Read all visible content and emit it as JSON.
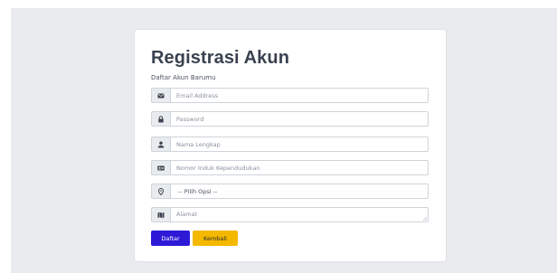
{
  "form": {
    "title": "Registrasi Akun",
    "subtitle": "Daftar Akun Barumu",
    "email": {
      "placeholder": "Email Address",
      "icon": "envelope-icon"
    },
    "password": {
      "placeholder": "Password",
      "icon": "lock-icon"
    },
    "full_name": {
      "placeholder": "Nama Lengkap",
      "icon": "user-icon"
    },
    "nik": {
      "placeholder": "Nomor Induk Kependudukan",
      "icon": "id-card-icon"
    },
    "location": {
      "selected": "-- Pilih Opsi --",
      "icon": "map-marker-icon"
    },
    "address": {
      "placeholder": "Alamat",
      "icon": "map-icon"
    },
    "submit_label": "Daftar",
    "back_label": "Kembali"
  },
  "colors": {
    "background": "#e9ebee",
    "primary_button": "#2e1ad6",
    "warning_button": "#f5b800"
  }
}
